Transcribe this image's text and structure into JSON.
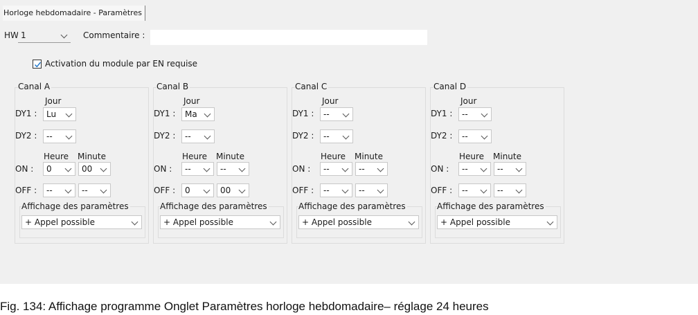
{
  "tab": {
    "label": "Horloge hebdomadaire - Paramètres"
  },
  "hw": {
    "label": "HW:",
    "value": "1"
  },
  "comment": {
    "label": "Commentaire :",
    "value": ""
  },
  "enable": {
    "label": "Activation du module par EN requise",
    "checked": true
  },
  "labels": {
    "jour": "Jour",
    "dy1": "DY1 :",
    "dy2": "DY2 :",
    "heure": "Heure",
    "minute": "Minute",
    "on": "ON :",
    "off": "OFF :",
    "display": "Affichage des paramètres"
  },
  "channels": [
    {
      "title": "Canal A",
      "dy1": "Lu",
      "dy2": "--",
      "on_h": "0",
      "on_m": "00",
      "off_h": "--",
      "off_m": "--",
      "display": "+ Appel possible"
    },
    {
      "title": "Canal B",
      "dy1": "Ma",
      "dy2": "--",
      "on_h": "--",
      "on_m": "--",
      "off_h": "0",
      "off_m": "00",
      "display": "+ Appel possible"
    },
    {
      "title": "Canal C",
      "dy1": "--",
      "dy2": "--",
      "on_h": "--",
      "on_m": "--",
      "off_h": "--",
      "off_m": "--",
      "display": "+ Appel possible"
    },
    {
      "title": "Canal D",
      "dy1": "--",
      "dy2": "--",
      "on_h": "--",
      "on_m": "--",
      "off_h": "--",
      "off_m": "--",
      "display": "+ Appel possible"
    }
  ],
  "caption": "Fig. 134: Affichage programme Onglet Paramètres horloge hebdomadaire– réglage 24 heures"
}
